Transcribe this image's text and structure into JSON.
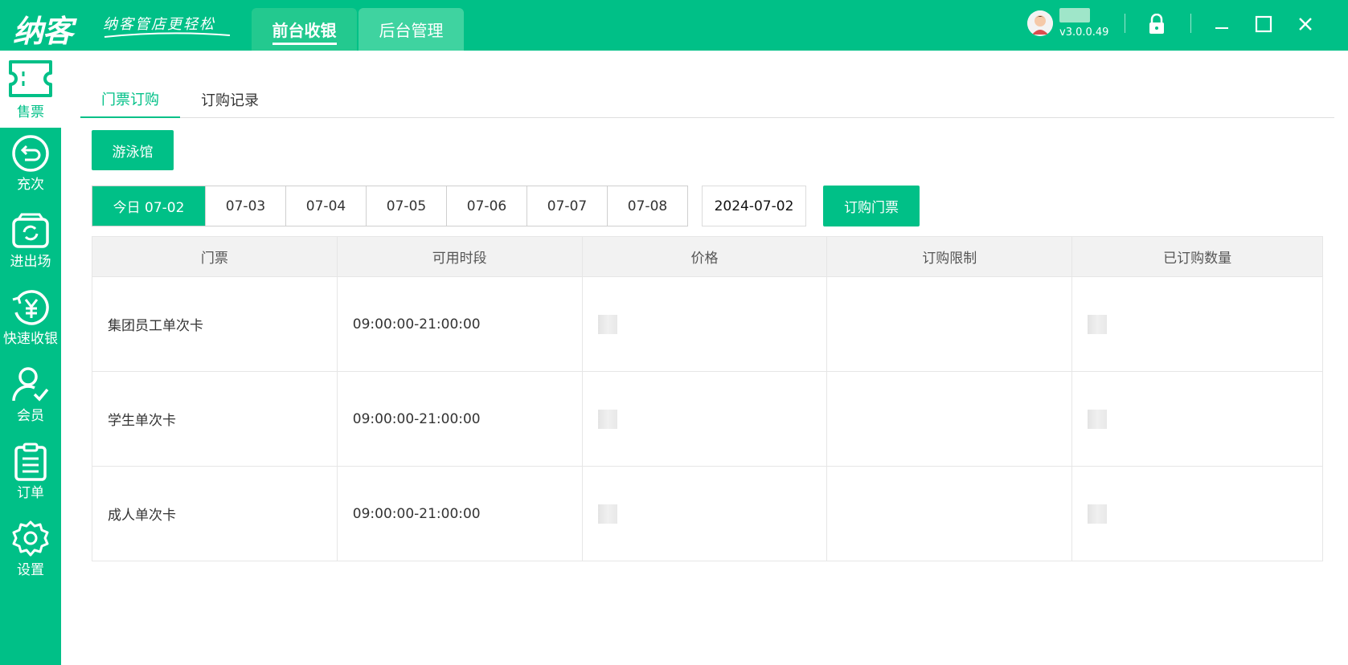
{
  "app": {
    "logo_text": "纳客",
    "slogan": "纳客管店更轻松",
    "top_tabs": [
      {
        "label": "前台收银",
        "active": true
      },
      {
        "label": "后台管理",
        "active": false
      }
    ],
    "version": "v3.0.0.49",
    "brand_color": "#00c087"
  },
  "sidebar": {
    "items": [
      {
        "label": "售票",
        "icon": "ticket-icon",
        "active": true
      },
      {
        "label": "充次",
        "icon": "recharge-icon",
        "active": false
      },
      {
        "label": "进出场",
        "icon": "entry-exit-icon",
        "active": false
      },
      {
        "label": "快速收银",
        "icon": "quick-cashier-icon",
        "active": false
      },
      {
        "label": "会员",
        "icon": "member-icon",
        "active": false
      },
      {
        "label": "订单",
        "icon": "order-icon",
        "active": false
      },
      {
        "label": "设置",
        "icon": "settings-icon",
        "active": false
      }
    ]
  },
  "main": {
    "subtabs": [
      {
        "label": "门票订购",
        "active": true
      },
      {
        "label": "订购记录",
        "active": false
      }
    ],
    "venue_button": "游泳馆",
    "dates": [
      "今日 07-02",
      "07-03",
      "07-04",
      "07-05",
      "07-06",
      "07-07",
      "07-08"
    ],
    "selected_date": "今日 07-02",
    "date_input_value": "2024-07-02",
    "order_button": "订购门票",
    "table": {
      "headers": [
        "门票",
        "可用时段",
        "价格",
        "订购限制",
        "已订购数量"
      ],
      "rows": [
        {
          "ticket": "集团员工单次卡",
          "period": "09:00:00-21:00:00",
          "price": "",
          "limit": "",
          "ordered": ""
        },
        {
          "ticket": "学生单次卡",
          "period": "09:00:00-21:00:00",
          "price": "",
          "limit": "",
          "ordered": ""
        },
        {
          "ticket": "成人单次卡",
          "period": "09:00:00-21:00:00",
          "price": "",
          "limit": "",
          "ordered": ""
        }
      ]
    }
  }
}
